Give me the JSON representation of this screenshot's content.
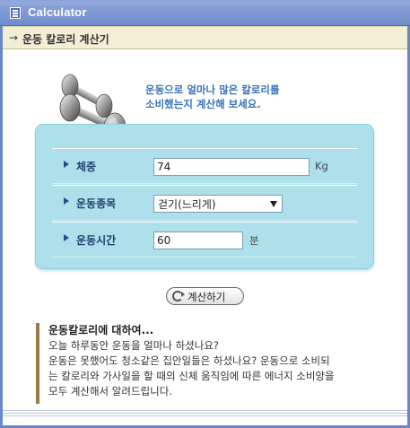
{
  "window": {
    "title": "Calculator"
  },
  "section": {
    "arrow": "→",
    "title": "운동 칼로리 계산기"
  },
  "intro": {
    "line1": "운동으로 얼마나 많은 칼로리를",
    "line2": "소비했는지 계산해 보세요."
  },
  "form": {
    "weight": {
      "label": "체중",
      "value": "74",
      "unit": "Kg"
    },
    "exercise": {
      "label": "운동종목",
      "selected": "걷기(느리게)"
    },
    "duration": {
      "label": "운동시간",
      "value": "60",
      "unit": "분"
    }
  },
  "button": {
    "label": "계산하기"
  },
  "info": {
    "title": "운동칼로리에 대하여...",
    "line1": "오늘 하루동안 운동을 얼마나 하셨나요?",
    "line2": "운동은 못했어도 청소같은 집안일들은 하셨나요? 운동으로 소비되",
    "line3": "는 칼로리와 가사일을 할 때의 신체 움직임에 따른 에너지 소비양을",
    "line4": "모두 계산해서 알려드립니다."
  },
  "colors": {
    "titlebar": "#7892d0",
    "panel": "#aee0ec",
    "intro_text": "#3a74b8",
    "section_bg": "#f2efd6"
  }
}
